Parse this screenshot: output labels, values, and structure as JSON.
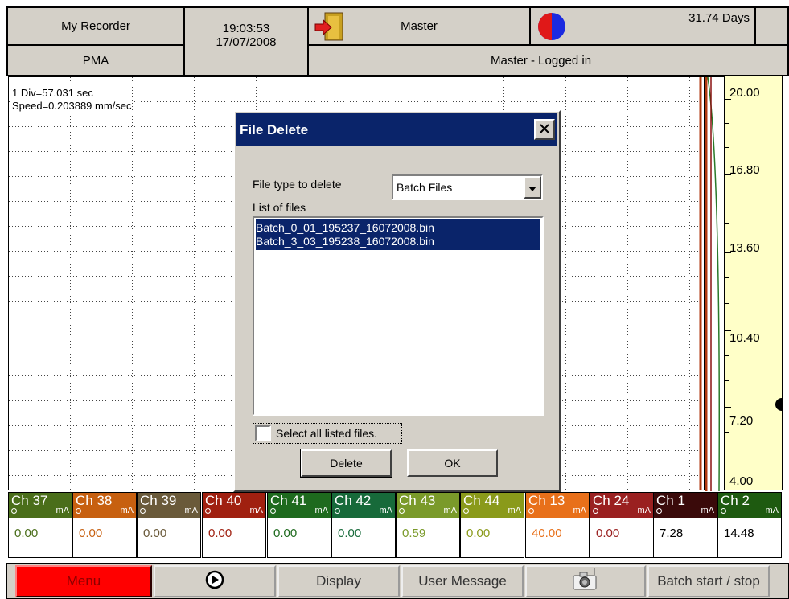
{
  "header": {
    "recorder_name": "My Recorder",
    "profile": "PMA",
    "time": "19:03:53",
    "date": "17/07/2008",
    "user_level": "Master",
    "user_status": "Master - Logged in",
    "memory_remaining": "31.74 Days",
    "icons": {
      "login": "door-arrow-icon",
      "memory": "pie-indicator-icon"
    }
  },
  "chart": {
    "div_text": "1 Div=57.031 sec",
    "speed_text": "Speed=0.203889 mm/sec",
    "scale_labels": [
      "20.00",
      "16.80",
      "13.60",
      "10.40",
      "7.20",
      "4.00"
    ]
  },
  "channels": [
    {
      "name": "Ch 37",
      "unit": "mA",
      "value": "0.00",
      "color": "#4a6e1a"
    },
    {
      "name": "Ch 38",
      "unit": "mA",
      "value": "0.00",
      "color": "#c76010"
    },
    {
      "name": "Ch 39",
      "unit": "mA",
      "value": "0.00",
      "color": "#6a5a3a"
    },
    {
      "name": "Ch 40",
      "unit": "mA",
      "value": "0.00",
      "color": "#a02010"
    },
    {
      "name": "Ch 41",
      "unit": "mA",
      "value": "0.00",
      "color": "#1e6a1e"
    },
    {
      "name": "Ch 42",
      "unit": "mA",
      "value": "0.00",
      "color": "#176a3a"
    },
    {
      "name": "Ch 43",
      "unit": "mA",
      "value": "0.59",
      "color": "#7a9a2a"
    },
    {
      "name": "Ch 44",
      "unit": "mA",
      "value": "0.00",
      "color": "#8a9a1a"
    },
    {
      "name": "Ch 13",
      "unit": "mA",
      "value": "40.00",
      "color": "#e8701a"
    },
    {
      "name": "Ch 24",
      "unit": "mA",
      "value": "0.00",
      "color": "#9a2020"
    },
    {
      "name": "Ch 1",
      "unit": "mA",
      "value": "7.28",
      "color": "#3a0a0a"
    },
    {
      "name": "Ch 2",
      "unit": "mA",
      "value": "14.48",
      "color": "#1e5a10"
    }
  ],
  "bottom_bar": {
    "menu": "Menu",
    "play_icon": "play-circle-icon",
    "display": "Display",
    "user_message": "User Message",
    "camera_icon": "camera-icon",
    "batch": "Batch start / stop"
  },
  "dialog": {
    "title": "File Delete",
    "file_type_label": "File type to delete",
    "file_type_value": "Batch Files",
    "list_label": "List of files",
    "files": [
      "Batch_0_01_195237_16072008.bin",
      "Batch_3_03_195238_16072008.bin"
    ],
    "select_all_label": "Select all listed files.",
    "delete_label": "Delete",
    "ok_label": "OK"
  },
  "colors": {
    "titlebar": "#0a246a",
    "menu_button": "#ff0000",
    "selection": "#0a246a",
    "scale_background": "#ffffc8"
  }
}
